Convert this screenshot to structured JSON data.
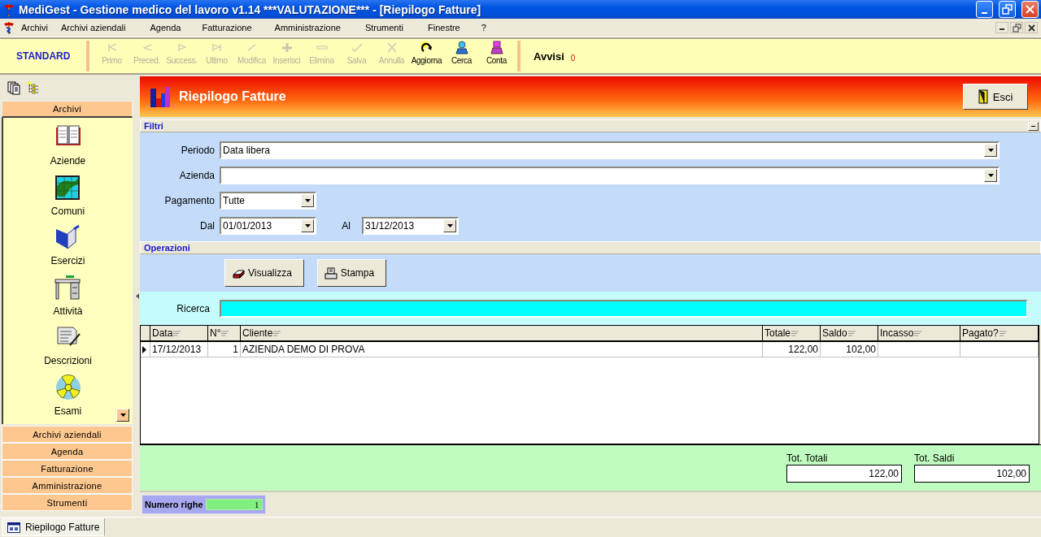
{
  "window": {
    "title": "MediGest - Gestione medico del lavoro v1.14 ***VALUTAZIONE*** - [Riepilogo Fatture]"
  },
  "menu": [
    {
      "label": "Archivi"
    },
    {
      "label": "Archivi aziendali"
    },
    {
      "label": "Agenda"
    },
    {
      "label": "Fatturazione"
    },
    {
      "label": "Amministrazione"
    },
    {
      "label": "Strumenti"
    },
    {
      "label": "Finestre"
    },
    {
      "label": "?"
    }
  ],
  "toolbar": {
    "mode": "STANDARD",
    "buttons": [
      {
        "label": "Primo",
        "disabled": true
      },
      {
        "label": "Preced.",
        "disabled": true
      },
      {
        "label": "Success.",
        "disabled": true
      },
      {
        "label": "Ultimo",
        "disabled": true
      },
      {
        "label": "Modifica",
        "disabled": true
      },
      {
        "label": "Inserisci",
        "disabled": true
      },
      {
        "label": "Elimina",
        "disabled": true
      },
      {
        "label": "Salva",
        "disabled": true
      },
      {
        "label": "Annulla",
        "disabled": true
      },
      {
        "label": "Aggiorna",
        "disabled": false
      },
      {
        "label": "Cerca",
        "disabled": false
      },
      {
        "label": "Conta",
        "disabled": false
      }
    ],
    "alerts": {
      "label": "Avvisi",
      "count": "0"
    }
  },
  "sidebar": {
    "open_group": "Archivi",
    "items": [
      {
        "label": "Aziende"
      },
      {
        "label": "Comuni"
      },
      {
        "label": "Esercizi"
      },
      {
        "label": "Attività"
      },
      {
        "label": "Descrizioni"
      },
      {
        "label": "Esami"
      }
    ],
    "groups": [
      {
        "label": "Archivi aziendali"
      },
      {
        "label": "Agenda"
      },
      {
        "label": "Fatturazione"
      },
      {
        "label": "Amministrazione"
      },
      {
        "label": "Strumenti"
      }
    ]
  },
  "report": {
    "title": "Riepilogo Fatture",
    "exit_button": "Esci",
    "filters": {
      "title": "Filtri",
      "rows": [
        {
          "fields": [
            {
              "label": "Periodo",
              "value": "Data libera"
            }
          ]
        },
        {
          "fields": [
            {
              "label": "Azienda"
            }
          ]
        },
        {
          "fields": [
            {
              "label": "Pagamento",
              "value": "Tutte"
            }
          ]
        },
        {
          "fields": [
            {
              "label": "Dal",
              "value": "01/01/2013"
            },
            {
              "label": "Al",
              "value": "31/12/2013"
            }
          ]
        }
      ]
    },
    "operations": {
      "title": "Operazioni",
      "buttons": [
        "Visualizza",
        "Stampa"
      ]
    },
    "search": {
      "label": "Ricerca"
    },
    "table": {
      "columns": [
        "Data",
        "N°",
        "Cliente",
        "Totale",
        "Saldo",
        "Incasso",
        "Pagato?"
      ],
      "rows": [
        {
          "selected": true,
          "cells": [
            "17/12/2013",
            "1",
            "AZIENDA DEMO DI PROVA",
            "122,00",
            "102,00"
          ]
        }
      ]
    },
    "totals": [
      {
        "label": "Tot. Totali",
        "value": "122,00"
      },
      {
        "label": "Tot. Saldi",
        "value": "102,00"
      }
    ],
    "row_count": {
      "label": "Numero righe",
      "value": "1"
    }
  },
  "taskbar": {
    "items": [
      {
        "label": "Riepilogo Fatture"
      }
    ]
  }
}
